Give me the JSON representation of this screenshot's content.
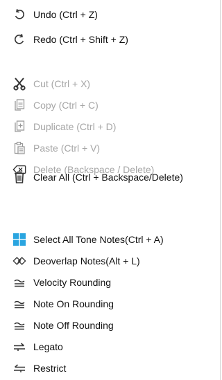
{
  "menu": {
    "items": [
      {
        "label": "Undo (Ctrl + Z)",
        "icon": "undo-icon",
        "enabled": true
      },
      {
        "label": "Redo (Ctrl + Shift + Z)",
        "icon": "redo-icon",
        "enabled": true
      },
      {
        "label": "Cut (Ctrl + X)",
        "icon": "scissors-icon",
        "enabled": false
      },
      {
        "label": "Copy (Ctrl + C)",
        "icon": "copy-icon",
        "enabled": false
      },
      {
        "label": "Duplicate (Ctrl + D)",
        "icon": "duplicate-icon",
        "enabled": false
      },
      {
        "label": "Paste (Ctrl + V)",
        "icon": "paste-icon",
        "enabled": false
      },
      {
        "label": "Delete (Backspace / Delete)",
        "icon": "delete-key-icon",
        "enabled": false
      },
      {
        "label": "Clear All (Ctrl + Backspace/Delete)",
        "icon": "trash-icon",
        "enabled": true
      },
      {
        "label": "Select All Tone Notes(Ctrl + A)",
        "icon": "grid-select-icon",
        "enabled": true
      },
      {
        "label": "Deoverlap Notes(Alt + L)",
        "icon": "deoverlap-icon",
        "enabled": true
      },
      {
        "label": "Velocity Rounding",
        "icon": "approx-equal-icon",
        "enabled": true
      },
      {
        "label": "Note On Rounding",
        "icon": "approx-equal-icon",
        "enabled": true
      },
      {
        "label": "Note Off Rounding",
        "icon": "approx-equal-icon",
        "enabled": true
      },
      {
        "label": "Legato",
        "icon": "legato-icon",
        "enabled": true
      },
      {
        "label": "Restrict",
        "icon": "restrict-icon",
        "enabled": true
      }
    ]
  },
  "colors": {
    "text": "#111111",
    "disabled_text": "#a6a6a6",
    "icon": "#333333",
    "disabled_icon": "#a0a0a0",
    "accent": "#2aa5e0"
  }
}
